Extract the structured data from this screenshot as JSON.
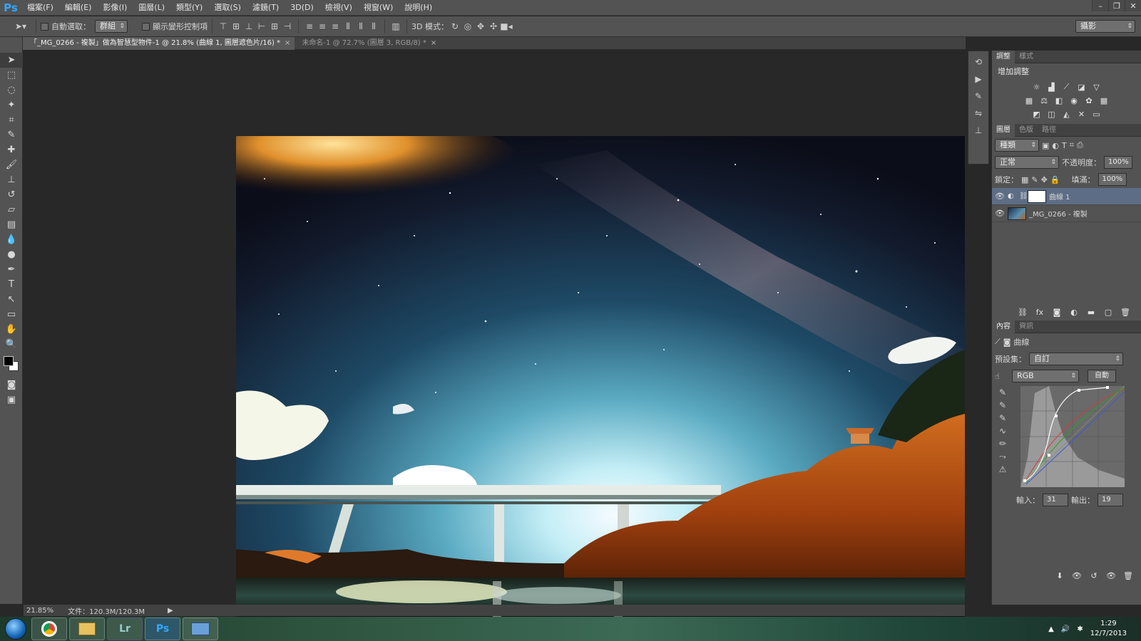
{
  "app": {
    "logo": "Ps"
  },
  "menu": [
    "檔案(F)",
    "編輯(E)",
    "影像(I)",
    "圖層(L)",
    "類型(Y)",
    "選取(S)",
    "濾鏡(T)",
    "3D(D)",
    "檢視(V)",
    "視窗(W)",
    "說明(H)"
  ],
  "window_controls": [
    "–",
    "❐",
    "✕"
  ],
  "options": {
    "auto_select_label": "自動選取：",
    "auto_select_value": "群組",
    "show_transform_label": "顯示變形控制項",
    "mode_3d_label": "3D 模式：",
    "workspace": "攝影"
  },
  "tabs": [
    {
      "label": "「_MG_0266 - 複製」做為智慧型物件-1 @ 21.8% (曲線 1, 圖層遮色片/16) *",
      "active": true
    },
    {
      "label": "未命名-1 @ 72.7% (圖層 3, RGB/8) *",
      "active": false
    }
  ],
  "adjustments_panel": {
    "tabs": [
      "調整",
      "樣式"
    ],
    "title": "增加調整"
  },
  "layers_panel": {
    "tabs": [
      "圖層",
      "色版",
      "路徑"
    ],
    "filter_kind": "種類",
    "blend_mode": "正常",
    "opacity_label": "不透明度：",
    "opacity_value": "100%",
    "lock_label": "鎖定：",
    "fill_label": "填滿：",
    "fill_value": "100%",
    "layers": [
      {
        "name": "曲線 1",
        "visible": true,
        "selected": true
      },
      {
        "name": "_MG_0266 - 複製",
        "visible": true,
        "selected": false
      }
    ]
  },
  "properties_panel": {
    "tabs": [
      "內容",
      "資訊"
    ],
    "title": "曲線",
    "preset_label": "預設集：",
    "preset_value": "自訂",
    "channel": "RGB",
    "auto_button": "自動",
    "input_label": "輸入：",
    "input_value": "31",
    "output_label": "輸出：",
    "output_value": "19"
  },
  "status": {
    "zoom": "21.85%",
    "doc_info": "文件：120.3M/120.3M"
  },
  "taskbar": {
    "apps": [
      "Chrome",
      "Explorer",
      "Lr",
      "Ps",
      "Preview"
    ],
    "time": "1:29",
    "date": "12/7/2013"
  }
}
